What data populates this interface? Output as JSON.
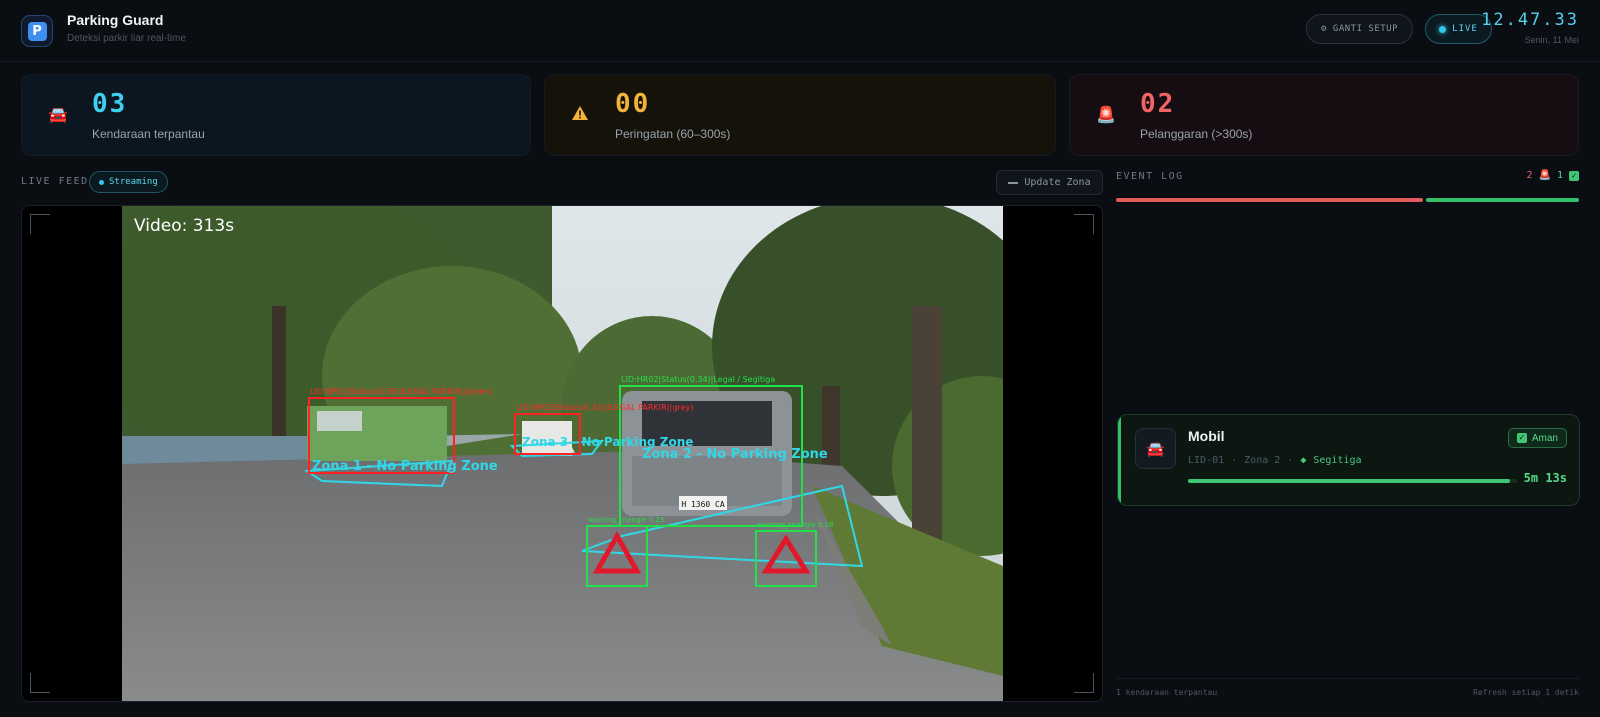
{
  "app": {
    "title": "Parking Guard",
    "subtitle": "Deteksi parkir liar real-time",
    "logo_letter": "P"
  },
  "header": {
    "setup_label": "GANTI SETUP",
    "live_label": "LIVE",
    "time": "12.47.33",
    "date": "Senin, 11 Mei"
  },
  "stats": [
    {
      "value": "03",
      "label": "Kendaraan terpantau",
      "icon": "car-icon",
      "color": "#3fd0f0"
    },
    {
      "value": "00",
      "label": "Peringatan (60–300s)",
      "icon": "warning-icon",
      "color": "#f2b33d"
    },
    {
      "value": "02",
      "label": "Pelanggaran (>300s)",
      "icon": "siren-icon",
      "color": "#f26464"
    }
  ],
  "feed": {
    "label": "LIVE FEED",
    "status": "Streaming",
    "update_label": "Update Zona"
  },
  "video": {
    "timer": "Video: 313s",
    "zones": [
      "Zona 1 - No Parking Zone",
      "Zona 2 - No Parking Zone",
      "Zona 3 - No Parking Zone"
    ],
    "detections": [
      {
        "label": "LID:NP01|Status(0.36)|ILEGAL PARKIR|(green)"
      },
      {
        "label": "LID:NP02|Status(0.34)|ILEGAL PARKIR|(grey)"
      },
      {
        "label": "LID:HR02|Status(0.34)|Legal / Segitiga"
      }
    ],
    "triangles": [
      {
        "label": "warning_triangle 0.23"
      },
      {
        "label": "warning_triangle 0.28"
      }
    ],
    "plate": "H 1360 CA"
  },
  "event_log": {
    "label": "EVENT LOG",
    "violations": "2",
    "safe": "1",
    "ratio": 0.667,
    "events": [
      {
        "title": "Mobil",
        "id": "LID-01",
        "zone": "Zona 2",
        "tag": "Segitiga",
        "status": "Aman",
        "duration": "5m 13s",
        "progress": 0.98
      }
    ]
  },
  "footer": {
    "count": "1 kendaraan terpantau",
    "refresh": "Refresh setiap 1 detik"
  }
}
